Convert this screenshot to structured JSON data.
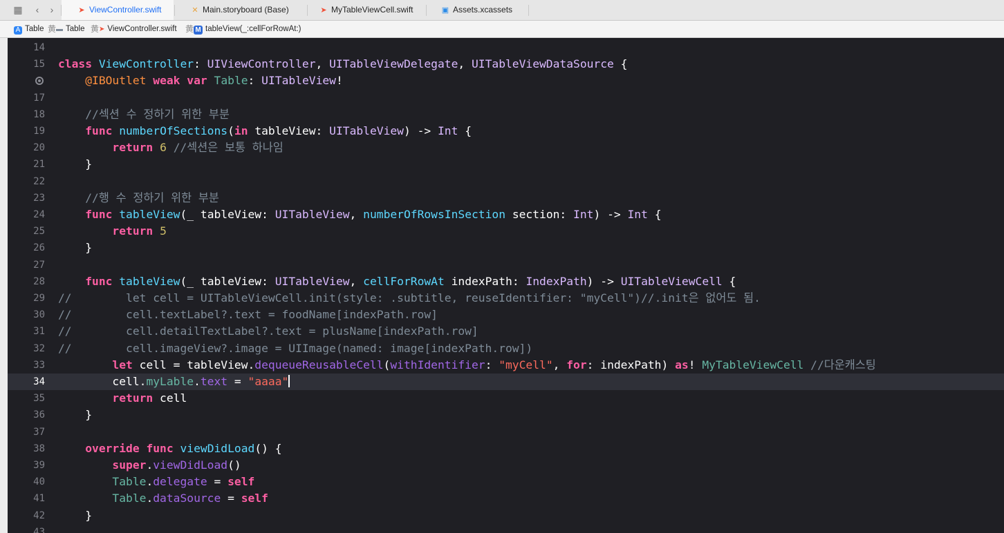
{
  "tabs": [
    {
      "label": "ViewController.swift",
      "icon": "swift-file-icon",
      "active": true
    },
    {
      "label": "Main.storyboard (Base)",
      "icon": "storyboard-icon",
      "active": false
    },
    {
      "label": "MyTableViewCell.swift",
      "icon": "swift-file-icon",
      "active": false
    },
    {
      "label": "Assets.xcassets",
      "icon": "asset-catalog-icon",
      "active": false
    }
  ],
  "breadcrumb": [
    {
      "label": "Table",
      "icon": "app-project-icon"
    },
    {
      "label": "Table",
      "icon": "folder-icon"
    },
    {
      "label": "ViewController.swift",
      "icon": "swift-file-icon"
    },
    {
      "label": "tableView(_:cellForRowAt:)",
      "icon": "method-icon"
    }
  ],
  "editor": {
    "current_line": 34,
    "lines": [
      {
        "num": "14",
        "text": ""
      },
      {
        "num": "15",
        "text": "class ViewController: UIViewController, UITableViewDelegate, UITableViewDataSource {"
      },
      {
        "num": "",
        "text": "    @IBOutlet weak var Table: UITableView!"
      },
      {
        "num": "17",
        "text": ""
      },
      {
        "num": "18",
        "text": "    //섹션 수 정하기 위한 부분"
      },
      {
        "num": "19",
        "text": "    func numberOfSections(in tableView: UITableView) -> Int {"
      },
      {
        "num": "20",
        "text": "        return 6 //섹션은 보통 하나임"
      },
      {
        "num": "21",
        "text": "    }"
      },
      {
        "num": "22",
        "text": ""
      },
      {
        "num": "23",
        "text": "    //행 수 정하기 위한 부분"
      },
      {
        "num": "24",
        "text": "    func tableView(_ tableView: UITableView, numberOfRowsInSection section: Int) -> Int {"
      },
      {
        "num": "25",
        "text": "        return 5"
      },
      {
        "num": "26",
        "text": "    }"
      },
      {
        "num": "27",
        "text": ""
      },
      {
        "num": "28",
        "text": "    func tableView(_ tableView: UITableView, cellForRowAt indexPath: IndexPath) -> UITableViewCell {"
      },
      {
        "num": "29",
        "text": "//        let cell = UITableViewCell.init(style: .subtitle, reuseIdentifier: \"myCell\")//.init은 없어도 됨."
      },
      {
        "num": "30",
        "text": "//        cell.textLabel?.text = foodName[indexPath.row]"
      },
      {
        "num": "31",
        "text": "//        cell.detailTextLabel?.text = plusName[indexPath.row]"
      },
      {
        "num": "32",
        "text": "//        cell.imageView?.image = UIImage(named: image[indexPath.row])"
      },
      {
        "num": "33",
        "text": "        let cell = tableView.dequeueReusableCell(withIdentifier: \"myCell\", for: indexPath) as! MyTableViewCell //다운캐스팅"
      },
      {
        "num": "34",
        "text": "        cell.myLable.text = \"aaaa\""
      },
      {
        "num": "35",
        "text": "        return cell"
      },
      {
        "num": "36",
        "text": "    }"
      },
      {
        "num": "37",
        "text": ""
      },
      {
        "num": "38",
        "text": "    override func viewDidLoad() {"
      },
      {
        "num": "39",
        "text": "        super.viewDidLoad()"
      },
      {
        "num": "40",
        "text": "        Table.delegate = self"
      },
      {
        "num": "41",
        "text": "        Table.dataSource = self"
      },
      {
        "num": "42",
        "text": "    }"
      },
      {
        "num": "43",
        "text": ""
      }
    ]
  },
  "colors": {
    "editor_bg": "#1f1f24",
    "keyword": "#fc5fa3",
    "type": "#dabaff",
    "declaration": "#5dd8ff",
    "project_type": "#67b7a4",
    "method": "#a167e6",
    "number": "#d0bf69",
    "string": "#fc6a5d",
    "comment": "#7f8c98",
    "attribute": "#fd8f3f",
    "active_tab": "#1f6ff5"
  }
}
